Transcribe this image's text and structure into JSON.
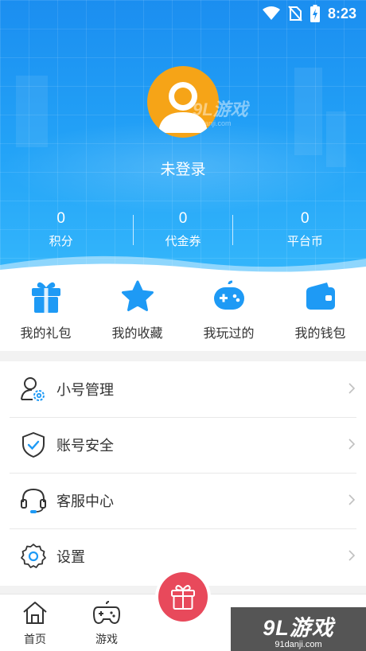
{
  "status_bar": {
    "time": "8:23",
    "icons": [
      "wifi-icon",
      "no-sim-icon",
      "battery-charging-icon"
    ]
  },
  "profile": {
    "username": "未登录",
    "avatar_icon": "default-avatar-icon",
    "avatar_color": "#f6a417"
  },
  "stats": [
    {
      "value": "0",
      "label": "积分"
    },
    {
      "value": "0",
      "label": "代金券"
    },
    {
      "value": "0",
      "label": "平台币"
    }
  ],
  "quick_actions": [
    {
      "label": "我的礼包",
      "icon": "gift-icon"
    },
    {
      "label": "我的收藏",
      "icon": "star-icon"
    },
    {
      "label": "我玩过的",
      "icon": "gamepad-icon"
    },
    {
      "label": "我的钱包",
      "icon": "wallet-icon"
    }
  ],
  "menu": [
    {
      "label": "小号管理",
      "icon": "user-gear-icon"
    },
    {
      "label": "账号安全",
      "icon": "shield-check-icon"
    },
    {
      "label": "客服中心",
      "icon": "headset-icon"
    },
    {
      "label": "设置",
      "icon": "settings-gear-icon"
    }
  ],
  "bottom_nav": [
    {
      "label": "首页",
      "icon": "home-icon"
    },
    {
      "label": "游戏",
      "icon": "joystick-icon"
    },
    {
      "label": "",
      "icon": "gift-icon"
    }
  ],
  "watermark": {
    "brand": "9L游戏",
    "domain": "91danji.com"
  },
  "colors": {
    "header_blue": "#1b8ef0",
    "accent_blue": "#1e9af5",
    "center_button": "#e8495b"
  }
}
